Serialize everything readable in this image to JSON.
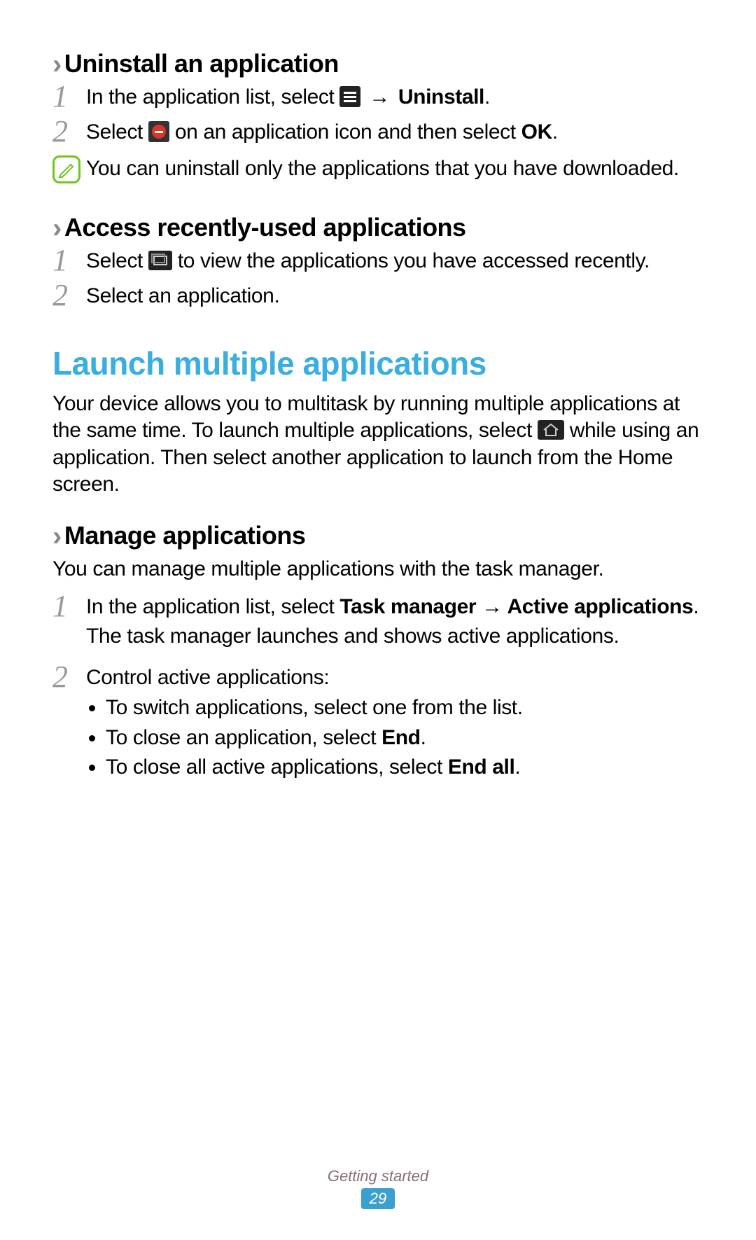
{
  "sections": {
    "uninstall": {
      "heading": "Uninstall an application",
      "step1_pre": "In the application list, select ",
      "step1_arrow": "→",
      "step1_bold": "Uninstall",
      "step1_post": ".",
      "step2_pre": "Select ",
      "step2_mid": " on an application icon and then select ",
      "step2_bold": "OK",
      "step2_post": ".",
      "note": "You can uninstall only the applications that you have downloaded."
    },
    "recent": {
      "heading": "Access recently-used applications",
      "step1_pre": "Select ",
      "step1_post": " to view the applications you have accessed recently.",
      "step2": "Select an application."
    },
    "launch": {
      "heading": "Launch multiple applications",
      "para_pre": "Your device allows you to multitask by running multiple applications at the same time. To launch multiple applications, select ",
      "para_post": " while using an application. Then select another application to launch from the Home screen."
    },
    "manage": {
      "heading": "Manage applications",
      "intro": "You can manage multiple applications with the task manager.",
      "step1_pre": "In the application list, select ",
      "step1_bold1": "Task manager",
      "step1_arrow": " → ",
      "step1_bold2": "Active applications",
      "step1_post": ".",
      "step1_after": "The task manager launches and shows active applications.",
      "step2_lead": "Control active applications:",
      "bullet1": "To switch applications, select one from the list.",
      "bullet2_pre": "To close an application, select ",
      "bullet2_bold": "End",
      "bullet2_post": ".",
      "bullet3_pre": "To close all active applications, select ",
      "bullet3_bold": "End all",
      "bullet3_post": "."
    }
  },
  "footer": {
    "section": "Getting started",
    "page": "29"
  },
  "nums": {
    "n1": "1",
    "n2": "2"
  }
}
